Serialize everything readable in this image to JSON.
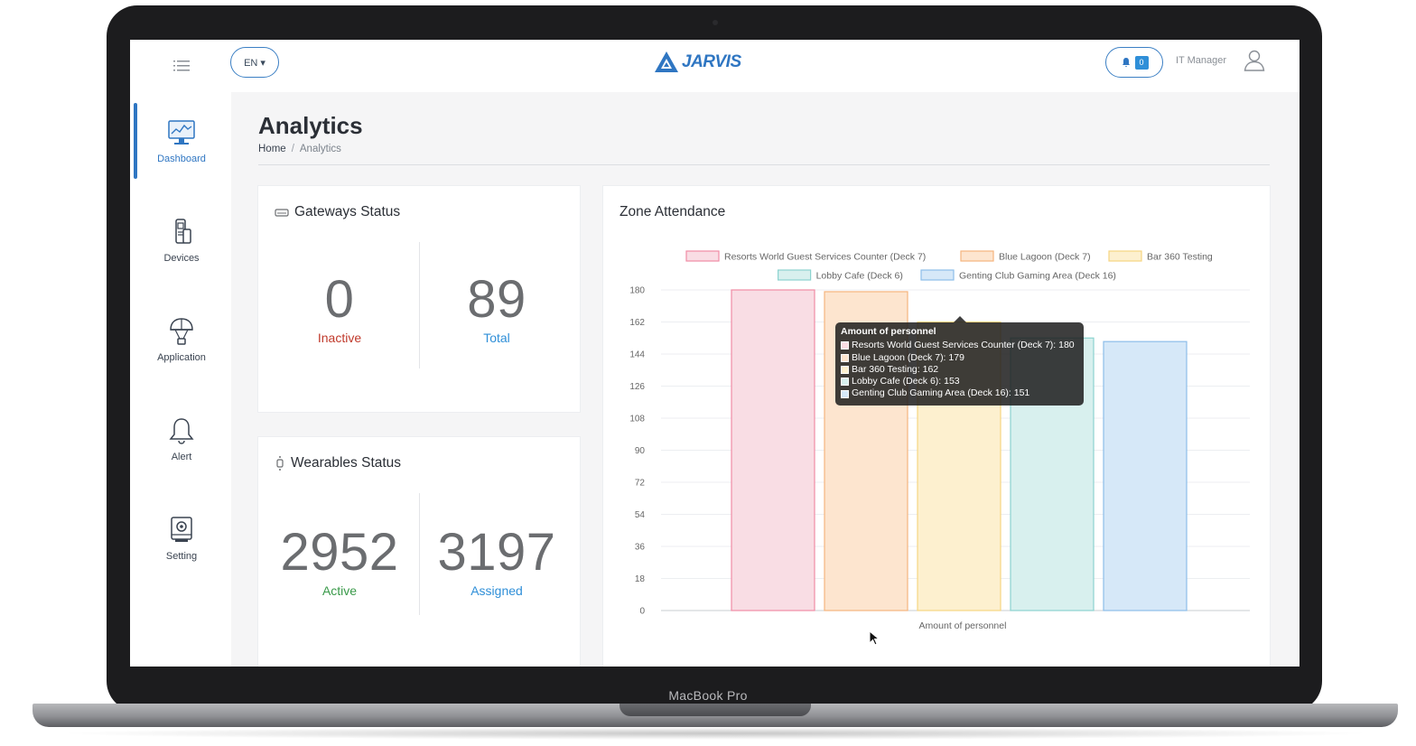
{
  "device": {
    "label": "MacBook Pro"
  },
  "header": {
    "language": "EN ▾",
    "logo_text": "JARVIS",
    "notification_count": "0",
    "user_role": "IT Manager"
  },
  "sidebar": {
    "items": [
      {
        "label": "Dashboard",
        "icon": "dashboard-icon",
        "active": true
      },
      {
        "label": "Devices",
        "icon": "devices-icon",
        "active": false
      },
      {
        "label": "Application",
        "icon": "application-icon",
        "active": false
      },
      {
        "label": "Alert",
        "icon": "bell-icon",
        "active": false
      },
      {
        "label": "Setting",
        "icon": "settings-icon",
        "active": false
      }
    ]
  },
  "page": {
    "title": "Analytics",
    "breadcrumb": {
      "home": "Home",
      "separator": "/",
      "current": "Analytics"
    }
  },
  "gateways": {
    "title": "Gateways Status",
    "inactive_value": "0",
    "inactive_label": "Inactive",
    "total_value": "89",
    "total_label": "Total"
  },
  "wearables": {
    "title": "Wearables Status",
    "active_value": "2952",
    "active_label": "Active",
    "assigned_value": "3197",
    "assigned_label": "Assigned"
  },
  "colors": {
    "brand": "#2f76c2",
    "inactive": "#c0392b",
    "total": "#2f8fd8",
    "active": "#3a9a4a",
    "assigned": "#2f8fd8"
  },
  "zone_chart": {
    "title": "Zone Attendance",
    "tooltip_title": "Amount of personnel",
    "tooltip_rows": [
      "Resorts World Guest Services Counter (Deck 7): 180",
      "Blue Lagoon (Deck 7): 179",
      "Bar 360 Testing: 162",
      "Lobby Cafe (Deck 6): 153",
      "Genting Club Gaming Area (Deck 16): 151"
    ]
  },
  "chart_data": {
    "type": "bar",
    "title": "",
    "xlabel": "Amount of personnel",
    "ylabel": "",
    "categories": [
      "Amount of personnel"
    ],
    "ylim": [
      0,
      180
    ],
    "yticks": [
      0,
      18,
      36,
      54,
      72,
      90,
      108,
      126,
      144,
      162,
      180
    ],
    "grid": true,
    "legend_position": "top",
    "series": [
      {
        "name": "Resorts World Guest Services Counter (Deck 7)",
        "values": [
          180
        ],
        "fill": "#f9dde4",
        "stroke": "#f08ca5"
      },
      {
        "name": "Blue Lagoon (Deck 7)",
        "values": [
          179
        ],
        "fill": "#fde5cf",
        "stroke": "#f5b57e"
      },
      {
        "name": "Bar 360 Testing",
        "values": [
          162
        ],
        "fill": "#fdf0cf",
        "stroke": "#f6d582"
      },
      {
        "name": "Lobby Cafe (Deck 6)",
        "values": [
          153
        ],
        "fill": "#d8f0ee",
        "stroke": "#8cd3cf"
      },
      {
        "name": "Genting Club Gaming Area (Deck 16)",
        "values": [
          151
        ],
        "fill": "#d6e8f8",
        "stroke": "#8dbde9"
      }
    ]
  }
}
